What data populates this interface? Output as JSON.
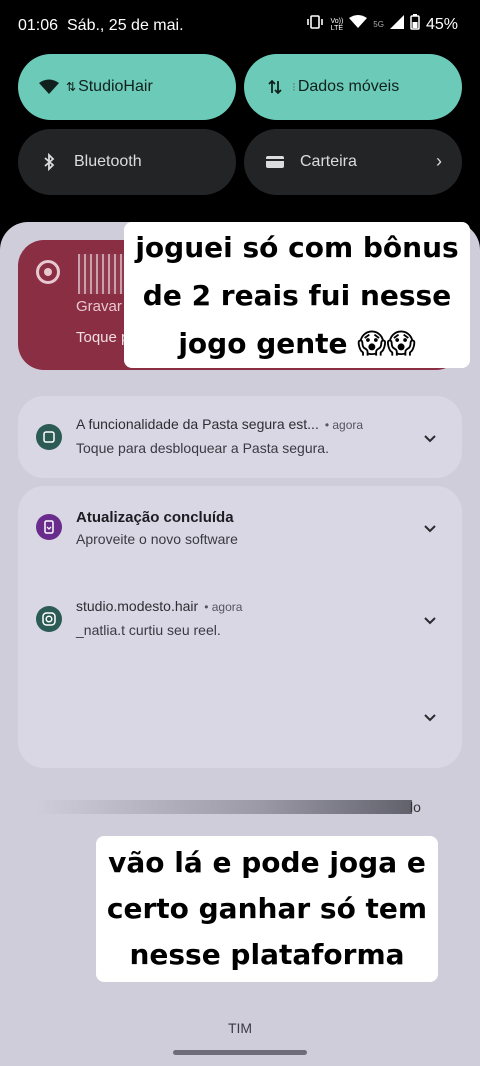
{
  "status_bar": {
    "time": "01:06",
    "date": "Sáb., 25 de mai.",
    "volte_label_1": "Vo))",
    "volte_label_2": "LTE",
    "network_label": "5G",
    "battery_percent": "45%"
  },
  "quick_tiles": [
    {
      "label": "StudioHair",
      "icon": "wifi-icon",
      "active": true
    },
    {
      "label": "Dados móveis",
      "icon": "mobile-data-icon",
      "active": true
    },
    {
      "label": "Bluetooth",
      "icon": "bluetooth-icon",
      "active": false
    },
    {
      "label": "Carteira",
      "icon": "wallet-icon",
      "active": false
    }
  ],
  "recording_card": {
    "title": "Gravar",
    "subtitle": "Toque para"
  },
  "notifications": [
    {
      "app_icon": "secure-folder-icon",
      "title": "A funcionalidade da Pasta segura est...",
      "time": "• agora",
      "text": "Toque para desbloquear a Pasta segura.",
      "icon_color": "#2c5a55"
    },
    {
      "app_icon": "software-update-icon",
      "title": "Atualização concluída",
      "text": "Aproveite o novo software",
      "icon_color": "#6a2c8c"
    },
    {
      "app_icon": "instagram-icon",
      "title": "studio.modesto.hair",
      "time": "• agora",
      "text": "_natlia.t curtiu seu reel.",
      "icon_color": "#2c5a55"
    }
  ],
  "overflow_text": "lo",
  "captions": {
    "top": [
      "joguei só com bônus",
      "de 2 reais fui nesse",
      "jogo gente 😱😱"
    ],
    "bottom": [
      "vão lá e pode joga e",
      "certo ganhar só tem",
      "nesse plataforma"
    ]
  },
  "carrier": "TIM",
  "colors": {
    "tile_active": "#6ccbb8",
    "tile_inactive": "#232426",
    "recording_card": "#8a2e44",
    "shade": "#cfcdda"
  }
}
